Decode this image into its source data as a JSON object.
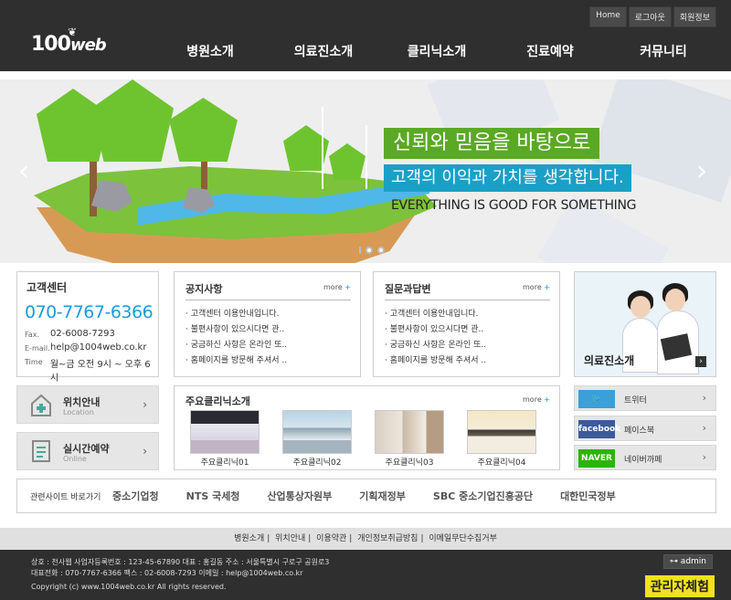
{
  "header": {
    "topbuttons": [
      "Home",
      "로그아웃",
      "회원정보"
    ],
    "logo_prefix": "100",
    "logo_suffix": "web",
    "nav": [
      "병원소개",
      "의료진소개",
      "클리닉소개",
      "진료예약",
      "커뮤니티"
    ]
  },
  "banner": {
    "line1": "신뢰와 믿음을 바탕으로",
    "line2": "고객의 이익과 가치를 생각합니다.",
    "line3": "EVERYTHING IS GOOD FOR SOMETHING",
    "prev": "‹",
    "next": "›",
    "colors": {
      "green": "#5aa924",
      "blue": "#1aa0c7"
    }
  },
  "customer_center": {
    "title": "고객센터",
    "phone": "070-7767-6366",
    "fax_label": "Fax.",
    "fax": "02-6008-7293",
    "email_label": "E-mail.",
    "email": "help@1004web.co.kr",
    "time_label": "Time",
    "time": "월~금 오전 9시 ~ 오후 6시"
  },
  "notice": {
    "title": "공지사항",
    "more": "more",
    "items": [
      "· 고객센터 이용안내입니다.",
      "· 불편사항이 있으시다면 관..",
      "· 궁금하신 사항은 온라인 또..",
      "· 홈페이지를 방문해 주셔서 .."
    ]
  },
  "faq": {
    "title": "질문과답변",
    "more": "more",
    "items": [
      "· 고객센터 이용안내입니다.",
      "· 불편사항이 있으시다면 관..",
      "· 궁금하신 사항은 온라인 또..",
      "· 홈페이지를 방문해 주셔서 .."
    ]
  },
  "doctors": {
    "label": "의료진소개",
    "arrow": "›"
  },
  "location": {
    "title": "위치안내",
    "sub": "Location",
    "arrow": "›",
    "icon": "hospital-icon"
  },
  "booking": {
    "title": "실시간예약",
    "sub": "Online",
    "arrow": "›",
    "icon": "document-icon"
  },
  "clinics": {
    "title": "주요클리닉소개",
    "more": "more",
    "items": [
      "주요클리닉01",
      "주요클리닉02",
      "주요클리닉03",
      "주요클리닉04"
    ]
  },
  "social": [
    {
      "name": "트위터",
      "logo": "twitter",
      "color": "#3b9fd8",
      "arrow": "›"
    },
    {
      "name": "페이스북",
      "logo": "facebook",
      "color": "#3b5b9a",
      "arrow": "›"
    },
    {
      "name": "네이버까페",
      "logo": "NAVER",
      "color": "#2db400",
      "arrow": "›"
    }
  ],
  "sites": {
    "lead": "관련사이트 바로가기",
    "items": [
      "중소기업청",
      "NTS 국세청",
      "산업통상자원부",
      "기획재정부",
      "SBC 중소기업진흥공단",
      "대한민국정부"
    ]
  },
  "footnav": [
    "병원소개",
    "위치안내",
    "이용약관",
    "개인정보취급방침",
    "이메일무단수집거부"
  ],
  "footer": {
    "line1": "상호 : 천사웹  사업자등록번호 : 123-45-67890  대표 : 홍길동  주소 : 서울특별시 구로구 공원로3",
    "line2": "대표전화 : 070-7767-6366  팩스 : 02-6008-7293  이메일 : help@1004web.co.kr",
    "line3": "Copyright (c) www.1004web.co.kr All rights reserved.",
    "admin": "⊶ admin",
    "admin_try": "관리자체험"
  }
}
